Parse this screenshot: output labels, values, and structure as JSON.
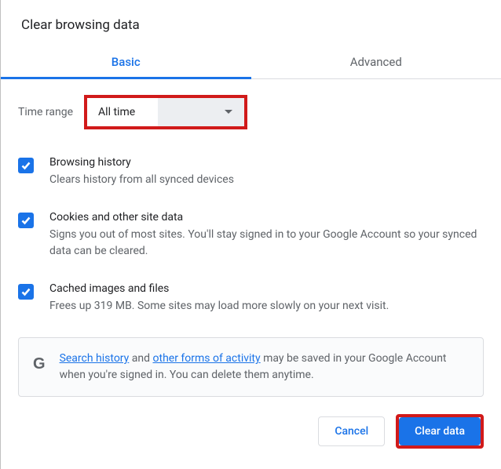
{
  "title": "Clear browsing data",
  "tabs": {
    "basic": "Basic",
    "advanced": "Advanced"
  },
  "time": {
    "label": "Time range",
    "value": "All time"
  },
  "options": {
    "browsing": {
      "title": "Browsing history",
      "desc": "Clears history from all synced devices"
    },
    "cookies": {
      "title": "Cookies and other site data",
      "desc": "Signs you out of most sites. You'll stay signed in to your Google Account so your synced data can be cleared."
    },
    "cache": {
      "title": "Cached images and files",
      "desc": "Frees up 319 MB. Some sites may load more slowly on your next visit."
    }
  },
  "info": {
    "link1": "Search history",
    "mid1": " and ",
    "link2": "other forms of activity",
    "rest": " may be saved in your Google Account when you're signed in. You can delete them anytime."
  },
  "actions": {
    "cancel": "Cancel",
    "clear": "Clear data"
  },
  "glyph": {
    "g": "G"
  }
}
